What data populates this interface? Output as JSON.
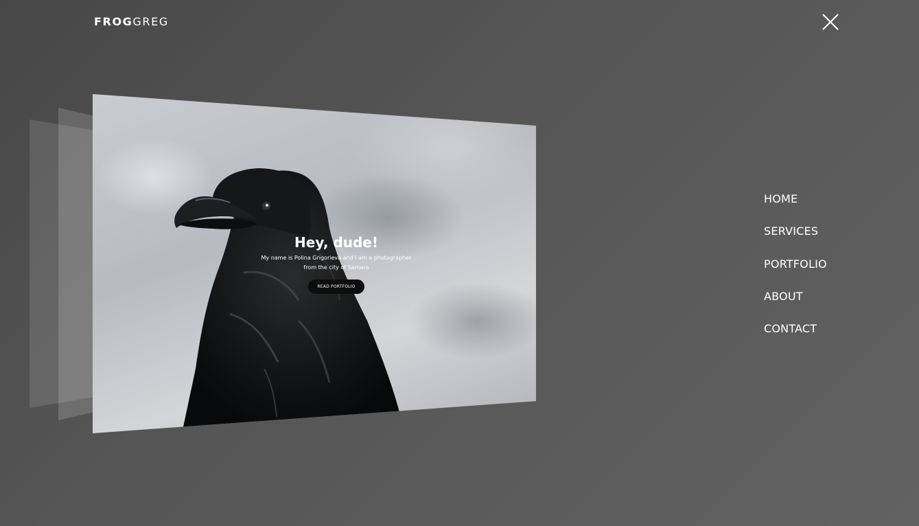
{
  "header": {
    "logo_bold": "FROG",
    "logo_light": "GREG",
    "close_icon": "close-icon"
  },
  "preview": {
    "hero_title": "Hey, dude!",
    "hero_text": "My name is Polina Grigorieva and I am a photographer from the city of Samara",
    "hero_button": "READ PORTFOLIO",
    "background_image": "raven-photo"
  },
  "menu": {
    "items": [
      {
        "label": "HOME"
      },
      {
        "label": "SERVICES"
      },
      {
        "label": "PORTFOLIO"
      },
      {
        "label": "ABOUT"
      },
      {
        "label": "CONTACT"
      }
    ]
  },
  "colors": {
    "background": "#555555",
    "text": "#ffffff",
    "button": "#0d0d0d"
  }
}
